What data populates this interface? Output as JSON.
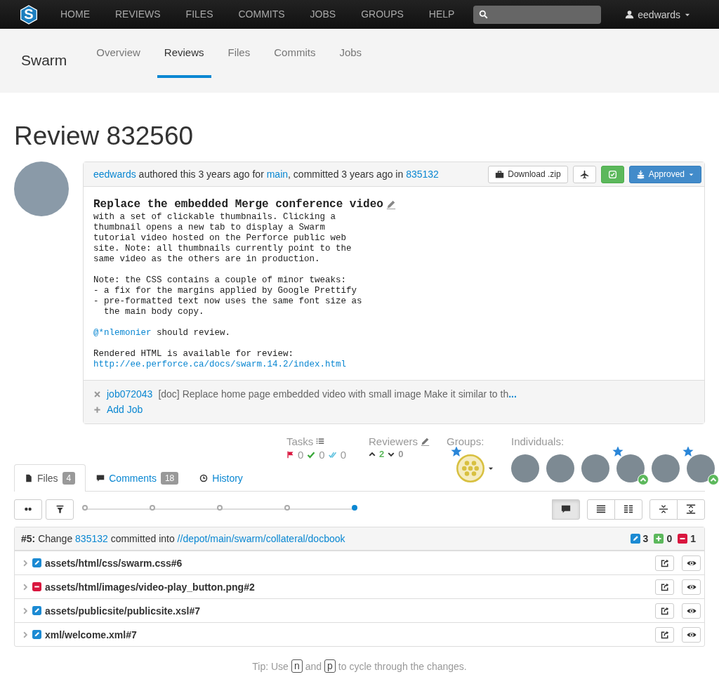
{
  "topnav": {
    "logo": "S",
    "items": [
      {
        "label": "HOME",
        "selected": false
      },
      {
        "label": "REVIEWS",
        "selected": false
      },
      {
        "label": "FILES",
        "selected": false
      },
      {
        "label": "COMMITS",
        "selected": false
      },
      {
        "label": "JOBS",
        "selected": false
      },
      {
        "label": "GROUPS",
        "selected": false
      },
      {
        "label": "HELP",
        "selected": false
      }
    ],
    "user": "eedwards"
  },
  "subnav": {
    "brand": "Swarm",
    "tabs": [
      {
        "label": "Overview",
        "selected": false
      },
      {
        "label": "Reviews",
        "selected": true
      },
      {
        "label": "Files",
        "selected": false
      },
      {
        "label": "Commits",
        "selected": false
      },
      {
        "label": "Jobs",
        "selected": false
      }
    ]
  },
  "review": {
    "title": "Review 832560",
    "byline": [
      {
        "kind": "link",
        "text": "eedwards"
      },
      {
        "kind": "text",
        "text": " authored this 3 years ago for "
      },
      {
        "kind": "link",
        "text": "main"
      },
      {
        "kind": "text",
        "text": ", committed 3 years ago in "
      },
      {
        "kind": "link",
        "text": "835132"
      }
    ],
    "download": "Download .zip",
    "state": "Approved",
    "description_title": "Replace the embedded Merge conference video",
    "description": [
      {
        "kind": "text",
        "text": "with a set of clickable thumbnails. Clicking a\nthumbnail opens a new tab to display a Swarm\ntutorial video hosted on the Perforce public web\nsite. Note: all thumbnails currently point to the\nsame video as the others are in production.\n\nNote: the CSS contains a couple of minor tweaks:\n- a fix for the margins applied by Google Prettify\n- pre-formatted text now uses the same font size as\n  the main body copy.\n\n"
      },
      {
        "kind": "link",
        "text": "@*nlemonier"
      },
      {
        "kind": "text",
        "text": " should review.\n\nRendered HTML is available for review:\n"
      },
      {
        "kind": "link",
        "text": "http://ee.perforce.ca/docs/swarm.14.2/index.html"
      }
    ],
    "jobs": [
      {
        "id": "job072043",
        "text": "[doc] Replace home page embedded video with small image Make it similar to th",
        "more": "..."
      }
    ],
    "add_job": "Add Job"
  },
  "tasks": {
    "label": "Tasks",
    "open": "0",
    "addressed": "0",
    "verified": "0"
  },
  "reviewers": {
    "label": "Reviewers",
    "up": "2",
    "down": "0"
  },
  "groups": {
    "label": "Groups:",
    "items": [
      {
        "starred": true
      }
    ]
  },
  "individuals": {
    "label": "Individuals:",
    "items": [
      {
        "starred": false,
        "approved": false
      },
      {
        "starred": false,
        "approved": false
      },
      {
        "starred": false,
        "approved": false
      },
      {
        "starred": true,
        "approved": true
      },
      {
        "starred": false,
        "approved": false
      },
      {
        "starred": true,
        "approved": true
      }
    ]
  },
  "tabs": [
    {
      "kind": "files",
      "label": "Files",
      "count": "4",
      "selected": true
    },
    {
      "kind": "comments",
      "label": "Comments",
      "count": "18",
      "selected": false
    },
    {
      "kind": "history",
      "label": "History",
      "selected": false
    }
  ],
  "versions": [
    {
      "selected": false
    },
    {
      "selected": false
    },
    {
      "selected": false
    },
    {
      "selected": false
    },
    {
      "selected": true
    }
  ],
  "view_toggles": [
    {
      "kind": "comments",
      "selected": true
    },
    {
      "kind": "unified",
      "selected": false
    },
    {
      "kind": "split",
      "selected": false
    },
    {
      "kind": "collapse",
      "selected": false
    },
    {
      "kind": "expand",
      "selected": false
    }
  ],
  "change": {
    "number": "#5:",
    "parts": [
      {
        "kind": "text",
        "text": "Change "
      },
      {
        "kind": "link",
        "text": "835132"
      },
      {
        "kind": "text",
        "text": " committed into "
      },
      {
        "kind": "link",
        "text": "//depot/main/swarm/collateral/docbook"
      }
    ],
    "counts": [
      {
        "kind": "edit",
        "value": "3"
      },
      {
        "kind": "add",
        "value": "0"
      },
      {
        "kind": "delete",
        "value": "1"
      }
    ]
  },
  "files": [
    {
      "kind": "edit",
      "path": "assets/html/css/swarm.css#6"
    },
    {
      "kind": "delete",
      "path": "assets/html/images/video-play_button.png#2"
    },
    {
      "kind": "edit",
      "path": "assets/publicsite/publicsite.xsl#7"
    },
    {
      "kind": "edit",
      "path": "xml/welcome.xml#7"
    }
  ],
  "tip": [
    {
      "kind": "text",
      "text": "Tip: Use"
    },
    {
      "kind": "key",
      "text": "n"
    },
    {
      "kind": "text",
      "text": "and"
    },
    {
      "kind": "key",
      "text": "p"
    },
    {
      "kind": "text",
      "text": "to cycle through the changes."
    }
  ]
}
